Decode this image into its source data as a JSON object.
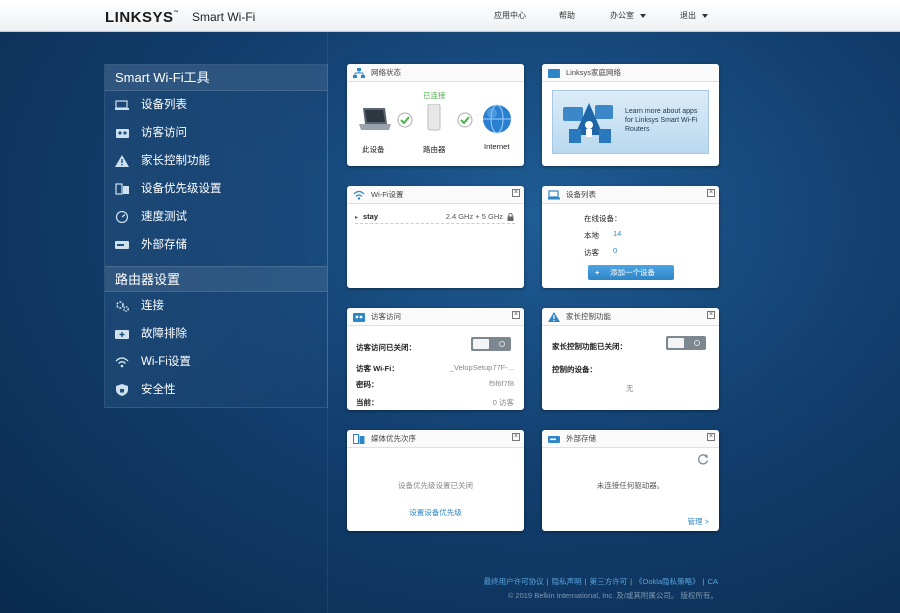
{
  "header": {
    "brand": "LINKSYS",
    "brand_tm": "™",
    "product": "Smart Wi-Fi",
    "nav": {
      "apps": "应用中心",
      "help": "帮助",
      "office": "办公室",
      "logout": "退出"
    }
  },
  "sidebar": {
    "tools_title": "Smart Wi-Fi工具",
    "tools": [
      {
        "label": "设备列表",
        "icon": "device-list-icon"
      },
      {
        "label": "访客访问",
        "icon": "guest-access-icon"
      },
      {
        "label": "家长控制功能",
        "icon": "parental-control-icon"
      },
      {
        "label": "设备优先级设置",
        "icon": "device-priority-icon"
      },
      {
        "label": "速度测试",
        "icon": "speed-test-icon"
      },
      {
        "label": "外部存储",
        "icon": "external-storage-icon"
      }
    ],
    "router_title": "路由器设置",
    "router": [
      {
        "label": "连接",
        "icon": "connectivity-icon"
      },
      {
        "label": "故障排除",
        "icon": "troubleshooting-icon"
      },
      {
        "label": "Wi-Fi设置",
        "icon": "wifi-icon"
      },
      {
        "label": "安全性",
        "icon": "security-icon"
      }
    ]
  },
  "cards": {
    "network": {
      "title": "网络状态",
      "connected": "已连接",
      "device_label": "此设备",
      "router_label": "路由器",
      "internet_label": "Internet"
    },
    "linksys_home": {
      "title": "Linksys家庭网络",
      "promo": "Learn more about apps for Linksys Smart Wi-Fi Routers"
    },
    "wifi": {
      "title": "Wi-Fi设置",
      "network_name": "stay",
      "bands": "2.4 GHz + 5 GHz"
    },
    "devices": {
      "title": "设备列表",
      "online_label": "在线设备：",
      "local_label": "本地",
      "local_count": "14",
      "guest_label": "访客",
      "guest_count": "0",
      "add_button": "添加一个设备"
    },
    "guest": {
      "title": "访客访问",
      "status_label": "访客访问已关闭：",
      "wifi_label": "访客 Wi-Fi：",
      "wifi_value": "_VelopSetup77F-...",
      "password_label": "密码：",
      "password_value": "f5f6f7f8",
      "current_label": "当前：",
      "current_value": "0 访客"
    },
    "parental": {
      "title": "家长控制功能",
      "status_label": "家长控制功能已关闭：",
      "controlled_label": "控制的设备：",
      "controlled_value": "无"
    },
    "media": {
      "title": "媒体优先次序",
      "status": "设备优先级设置已关闭",
      "link": "设置设备优先级"
    },
    "storage": {
      "title": "外部存储",
      "status": "未连接任何驱动器。",
      "manage": "管理 >"
    }
  },
  "footer": {
    "links": [
      "最终用户许可协议",
      "隐私声明",
      "第三方许可",
      "《Ookla隐私策略》",
      "CA"
    ],
    "copyright": "© 2019 Belkin International, Inc. 及/或其附属公司。 版权所有。"
  },
  "colors": {
    "accent": "#2f86c6",
    "background": "#123f6f",
    "button": "#3a8fd0"
  }
}
